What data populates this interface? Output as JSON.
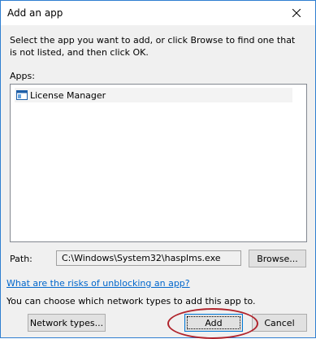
{
  "dialog": {
    "title": "Add an app",
    "close_icon": "close-icon",
    "instructions": "Select the app you want to add, or click Browse to find one that is not listed, and then click OK.",
    "apps_label": "Apps:",
    "apps": [
      {
        "label": "License Manager",
        "icon": "app-window-icon"
      }
    ],
    "path_label": "Path:",
    "path_value": "C:\\Windows\\System32\\hasplms.exe",
    "browse_label": "Browse...",
    "risks_link": "What are the risks of unblocking an app?",
    "network_note": "You can choose which network types to add this app to.",
    "network_types_label": "Network types...",
    "add_label": "Add",
    "cancel_label": "Cancel"
  },
  "colors": {
    "border_accent": "#2f7fd1",
    "link": "#0066cc",
    "annotation_oval": "#b0232b"
  }
}
